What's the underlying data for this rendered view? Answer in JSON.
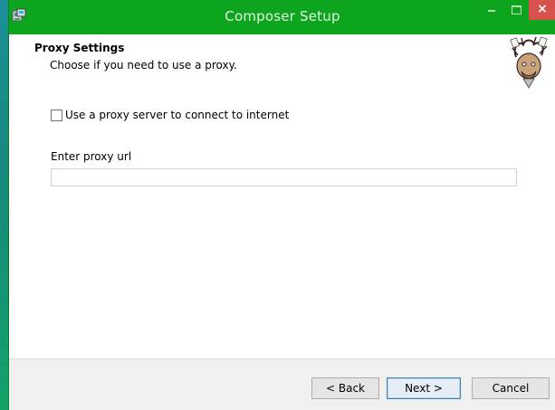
{
  "window": {
    "title": "Composer Setup",
    "icons": {
      "app": "installer-icon",
      "minimize": "minimize-icon",
      "maximize": "maximize-icon",
      "close": "close-icon"
    },
    "colors": {
      "titlebar": "#0ea51e",
      "close": "#d7514d"
    }
  },
  "header": {
    "title": "Proxy Settings",
    "subtitle": "Choose if you need to use a proxy.",
    "logo": "composer-mascot"
  },
  "proxy": {
    "checkbox_label": "Use a proxy server to connect to internet",
    "checkbox_checked": false,
    "url_label": "Enter proxy url",
    "url_value": ""
  },
  "buttons": {
    "back": "< Back",
    "next": "Next >",
    "cancel": "Cancel"
  }
}
